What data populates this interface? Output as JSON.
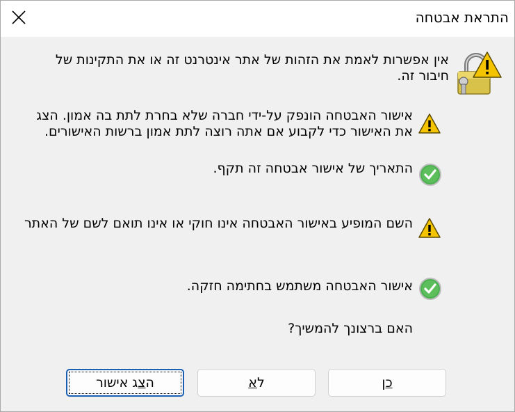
{
  "window": {
    "title": "התראת אבטחה"
  },
  "intro": "אין אפשרות לאמת את הזהות של אתר אינטרנט זה או את התקינות של חיבור זה.",
  "items": [
    {
      "icon": "warning-icon",
      "text": "אישור האבטחה הונפק על-ידי חברה שלא בחרת לתת בה אמון. הצג את האישור כדי לקבוע אם אתה רוצה לתת אמון ברשות האישורים."
    },
    {
      "icon": "check-icon",
      "text": "התאריך של אישור אבטחה זה תקף."
    },
    {
      "icon": "warning-icon",
      "text": "השם המופיע באישור האבטחה אינו חוקי או אינו תואם לשם של האתר"
    },
    {
      "icon": "check-icon",
      "text": "אישור האבטחה משתמש בחתימה חזקה."
    }
  ],
  "question": "האם ברצונך להמשיך?",
  "buttons": {
    "yes": {
      "label": "כן",
      "accel": "כ",
      "rest": "ן"
    },
    "no": {
      "label": "לא",
      "accel": "א",
      "lead": "ל"
    },
    "view": {
      "label": "הצג אישור",
      "lead": "ה",
      "accel": "צ",
      "rest": "ג אישור"
    }
  },
  "colors": {
    "warning": "#f5c400",
    "check": "#4caf50",
    "accent": "#1a5fb4"
  }
}
